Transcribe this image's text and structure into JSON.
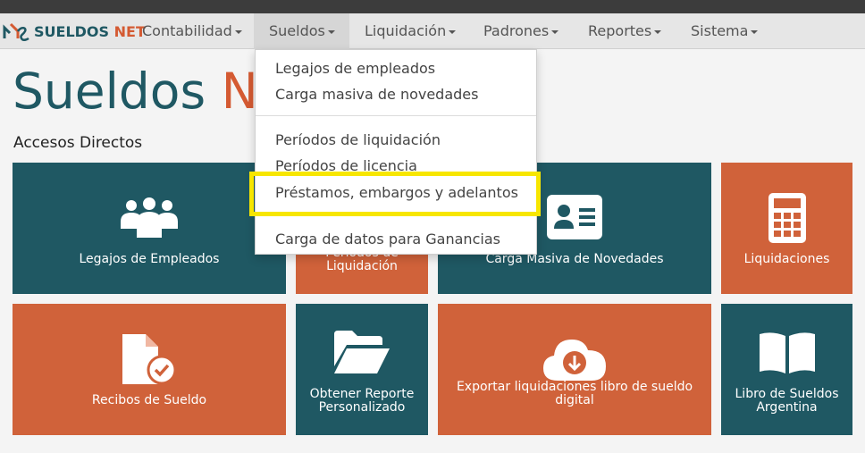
{
  "brand": {
    "name_part1": "SUELDOS",
    "name_part2": "NET"
  },
  "nav": {
    "items": [
      {
        "label": "Contabilidad"
      },
      {
        "label": "Sueldos"
      },
      {
        "label": "Liquidación"
      },
      {
        "label": "Padrones"
      },
      {
        "label": "Reportes"
      },
      {
        "label": "Sistema"
      }
    ]
  },
  "page": {
    "title_part1": "Sueldos ",
    "title_part2": "Ne",
    "section_title": "Accesos Directos"
  },
  "dropdown": {
    "items": [
      {
        "label": "Legajos de empleados"
      },
      {
        "label": "Carga masiva de novedades"
      },
      {
        "label": "Períodos de liquidación"
      },
      {
        "label": "Períodos de licencia"
      },
      {
        "label": "Préstamos, embargos y adelantos"
      },
      {
        "label": "Carga de datos para Ganancias"
      }
    ]
  },
  "tiles": [
    {
      "label": "Legajos de Empleados",
      "icon": "users-icon",
      "color": "#1f5863"
    },
    {
      "label": "Períodos de Liquidación",
      "icon": "calendar-icon",
      "color": "#d0623a"
    },
    {
      "label": "Carga Masiva de Novedades",
      "icon": "id-card-icon",
      "color": "#1f5863"
    },
    {
      "label": "Liquidaciones",
      "icon": "calculator-icon",
      "color": "#d0623a"
    },
    {
      "label": "Recibos de Sueldo",
      "icon": "file-check-icon",
      "color": "#d0623a"
    },
    {
      "label": "Obtener Reporte Personalizado",
      "icon": "folder-open-icon",
      "color": "#1f5863"
    },
    {
      "label": "Exportar liquidaciones libro de sueldo digital",
      "icon": "cloud-download-icon",
      "color": "#d0623a"
    },
    {
      "label": "Libro de Sueldos Argentina",
      "icon": "book-open-icon",
      "color": "#1f5863"
    }
  ],
  "colors": {
    "teal": "#1f5863",
    "orange": "#d0623a",
    "highlight": "#f7e600"
  }
}
